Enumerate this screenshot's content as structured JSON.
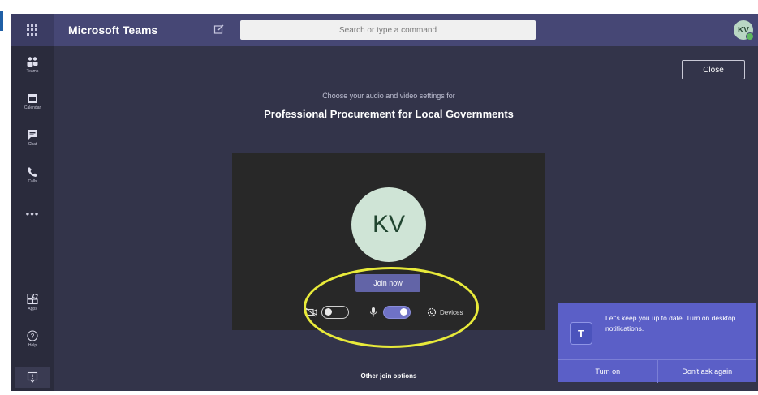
{
  "app": {
    "name": "Microsoft Teams",
    "search_placeholder": "Search or type a command",
    "user_initials": "KV"
  },
  "rail": {
    "items": [
      {
        "label": "Teams",
        "icon": "teams-icon"
      },
      {
        "label": "Calendar",
        "icon": "calendar-icon"
      },
      {
        "label": "Chat",
        "icon": "chat-icon"
      },
      {
        "label": "Calls",
        "icon": "phone-icon"
      }
    ],
    "more": "•••",
    "bottom_items": [
      {
        "label": "Apps",
        "icon": "apps-icon"
      },
      {
        "label": "Help",
        "icon": "help-icon"
      }
    ],
    "feedback_icon": "feedback-icon"
  },
  "prejoin": {
    "close_label": "Close",
    "subtitle": "Choose your audio and video settings for",
    "meeting_title": "Professional Procurement for Local Governments",
    "avatar_initials": "KV",
    "join_label": "Join now",
    "camera_on": false,
    "mic_on": true,
    "devices_label": "Devices",
    "other_options": "Other join options"
  },
  "toast": {
    "icon_letter": "T",
    "message": "Let's keep you up to date. Turn on desktop notifications.",
    "turn_on": "Turn on",
    "dont_ask": "Don't ask again"
  },
  "colors": {
    "topbar": "#464775",
    "background": "#33344a",
    "rail": "#2a2b3c",
    "accent": "#6264a7",
    "highlight": "#e8ea3a"
  }
}
